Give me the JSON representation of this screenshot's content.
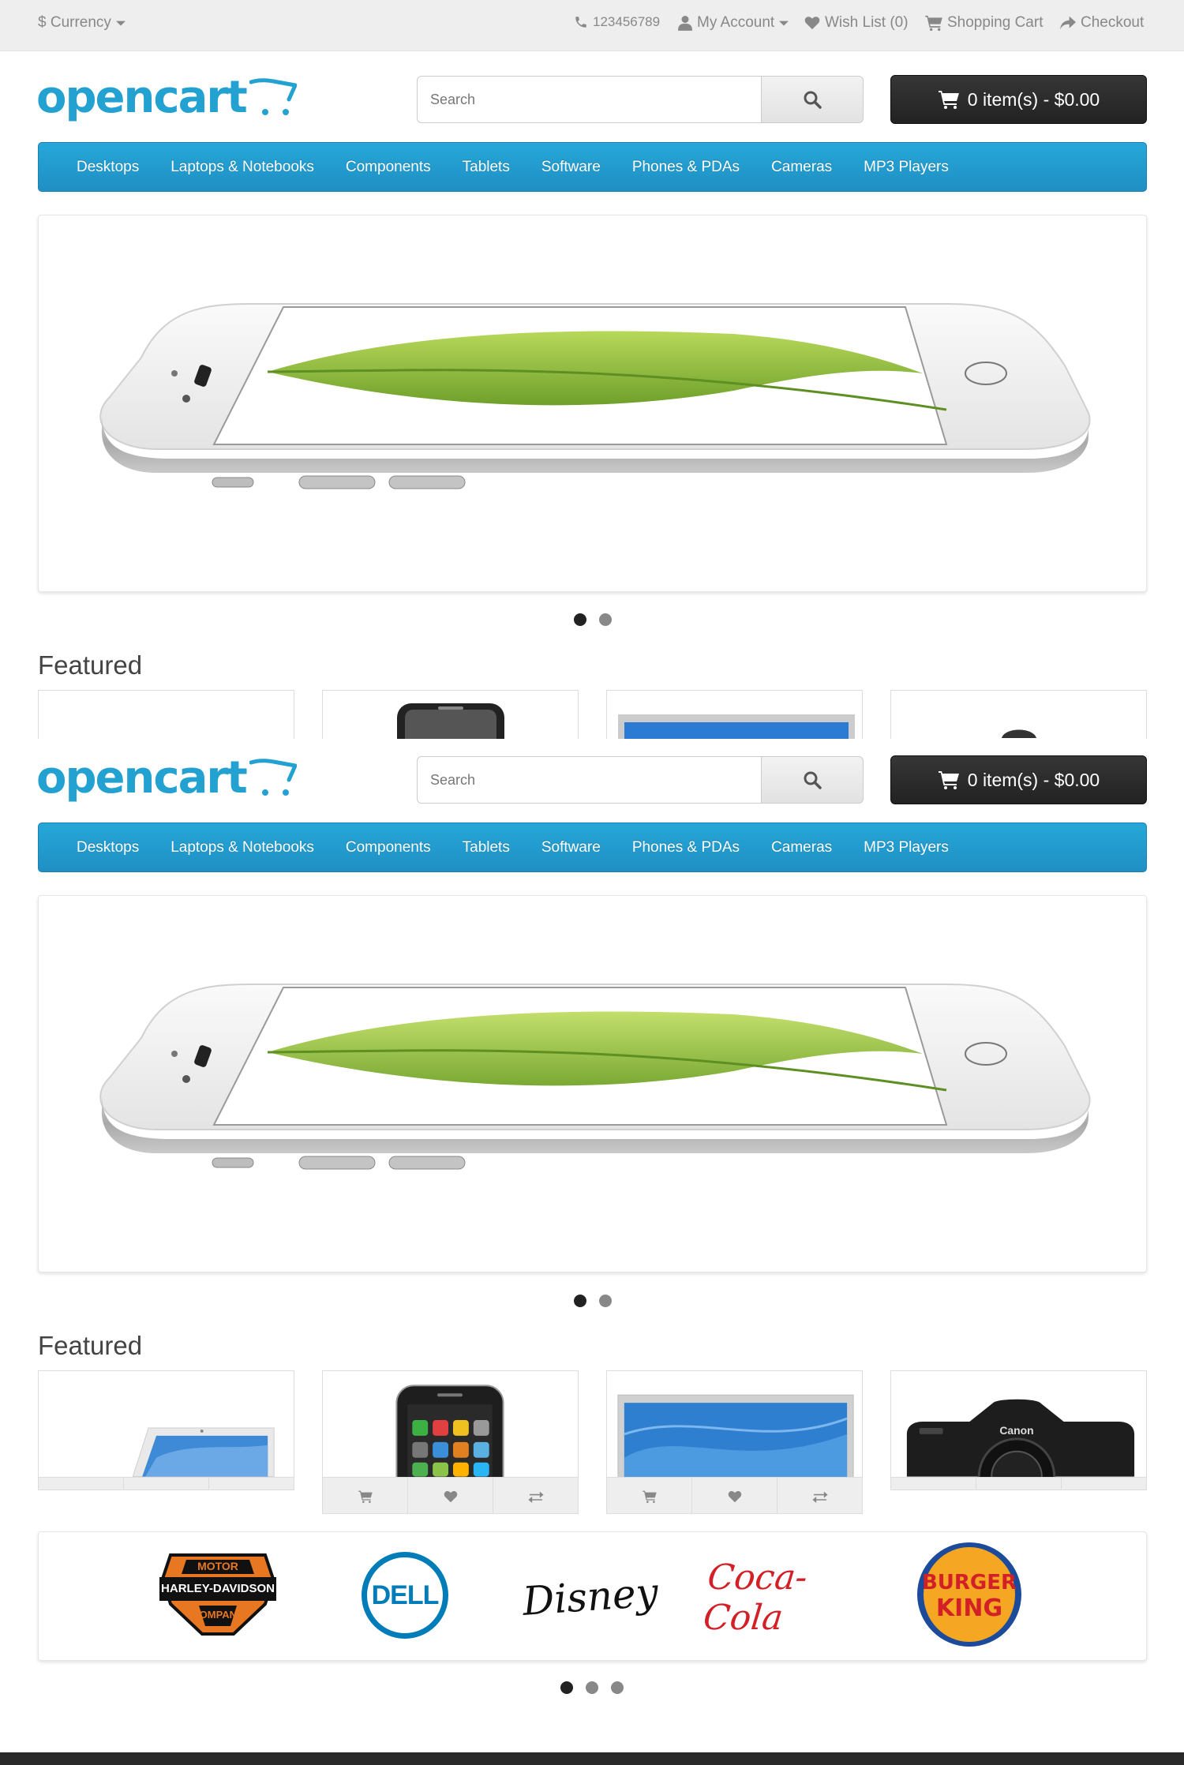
{
  "topbar": {
    "currency": "$ Currency",
    "phone": "123456789",
    "my_account": "My Account",
    "wish_list": "Wish List (0)",
    "shopping_cart": "Shopping Cart",
    "checkout": "Checkout"
  },
  "header": {
    "logo_text": "opencart",
    "search_placeholder": "Search",
    "cart_label": "0 item(s) - $0.00"
  },
  "menu": {
    "items": [
      "Desktops",
      "Laptops & Notebooks",
      "Components",
      "Tablets",
      "Software",
      "Phones & PDAs",
      "Cameras",
      "MP3 Players"
    ]
  },
  "slideshow": {
    "slides": 2,
    "active": 1
  },
  "featured": {
    "title": "Featured",
    "products": [
      "macbook",
      "iphone",
      "apple-cinema-display",
      "canon-eos-5d"
    ]
  },
  "brands": {
    "items": [
      {
        "name": "harley-davidson",
        "line1": "MOTOR",
        "line2": "HARLEY-DAVIDSON",
        "line3": "COMPANY"
      },
      {
        "name": "dell",
        "text": "DELL"
      },
      {
        "name": "disney",
        "text": "Disney"
      },
      {
        "name": "coca-cola",
        "text": "Coca-Cola"
      },
      {
        "name": "burger-king",
        "line1": "BURGER",
        "line2": "KING"
      }
    ],
    "dots": 3,
    "active": 1
  },
  "colors": {
    "brand": "#23a1d1",
    "menu": "#229ac8",
    "cart": "#222222",
    "topbar": "#eeeeee"
  },
  "icons": [
    "phone-icon",
    "user-icon",
    "heart-icon",
    "cart-icon",
    "share-icon",
    "search-icon",
    "caret-down-icon",
    "exchange-icon"
  ]
}
